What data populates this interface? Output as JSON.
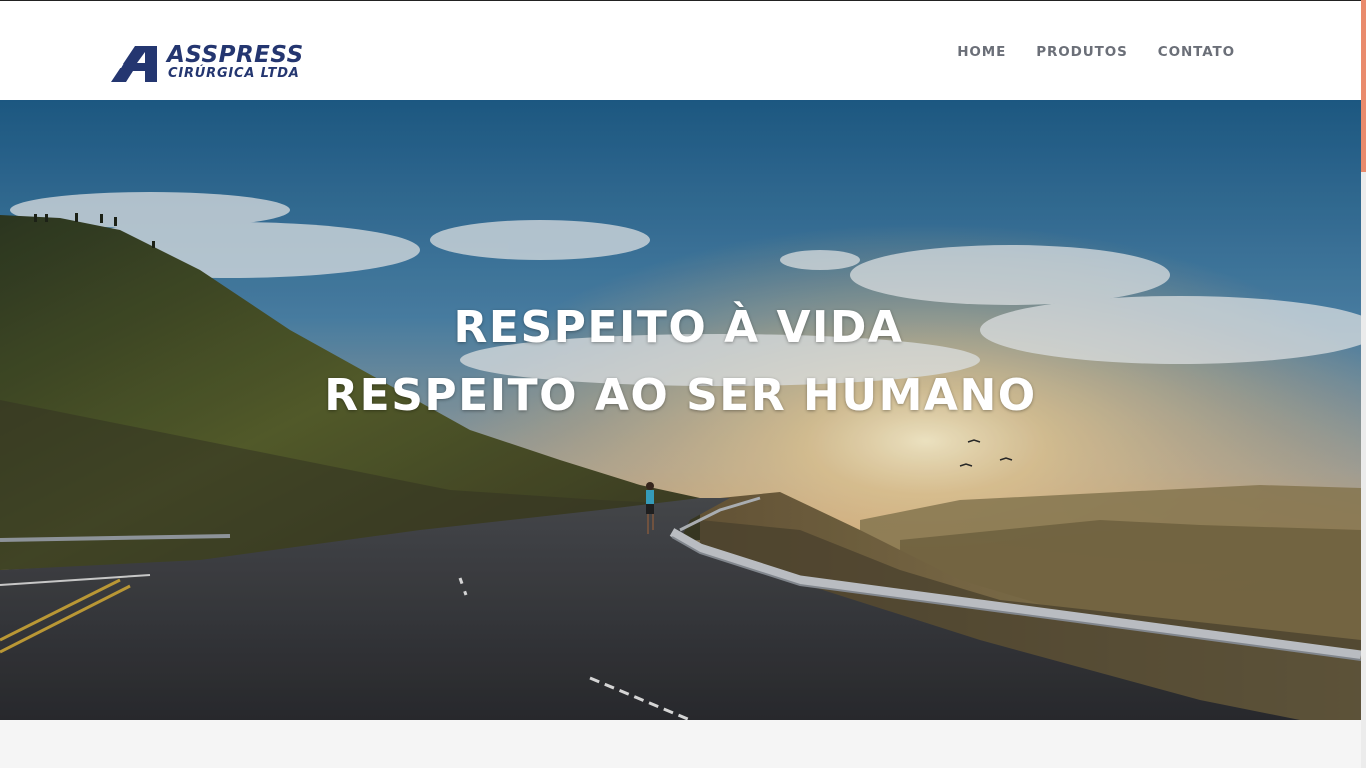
{
  "logo": {
    "name": "ASSPRESS",
    "subtitle": "CIRÚRGICA LTDA",
    "brand_color": "#243670"
  },
  "nav": {
    "items": [
      {
        "label": "HOME"
      },
      {
        "label": "PRODUTOS"
      },
      {
        "label": "CONTATO"
      }
    ]
  },
  "hero": {
    "line1": "RESPEITO À VIDA",
    "line2": "RESPEITO AO SER HUMANO"
  },
  "colors": {
    "accent": "#e98b6c",
    "nav_text": "#6b6f78"
  }
}
